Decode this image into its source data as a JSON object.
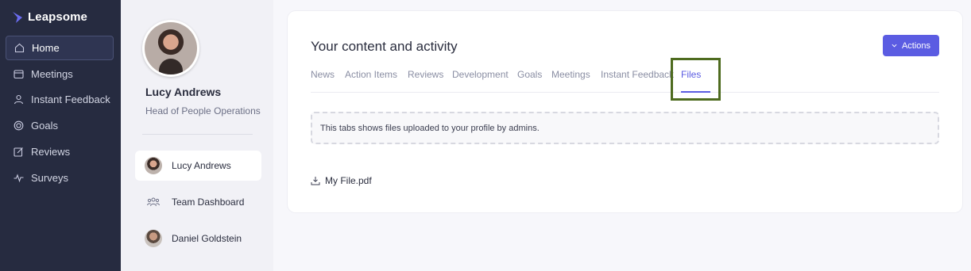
{
  "brand": {
    "name": "Leapsome",
    "accent": "#5b5ce2"
  },
  "nav": {
    "items": [
      {
        "label": "Home",
        "icon": "home-icon",
        "active": true
      },
      {
        "label": "Meetings",
        "icon": "meetings-icon",
        "active": false
      },
      {
        "label": "Instant Feedback",
        "icon": "feedback-icon",
        "active": false
      },
      {
        "label": "Goals",
        "icon": "goals-icon",
        "active": false
      },
      {
        "label": "Reviews",
        "icon": "reviews-icon",
        "active": false
      },
      {
        "label": "Surveys",
        "icon": "surveys-icon",
        "active": false
      }
    ]
  },
  "profile": {
    "name": "Lucy Andrews",
    "role": "Head of People Operations",
    "people": [
      {
        "label": "Lucy Andrews",
        "icon": "avatar",
        "selected": true
      },
      {
        "label": "Team Dashboard",
        "icon": "team-icon",
        "selected": false
      },
      {
        "label": "Daniel Goldstein",
        "icon": "avatar",
        "selected": false
      }
    ]
  },
  "main": {
    "title": "Your content and activity",
    "actions_label": "Actions",
    "tabs": [
      {
        "label": "News",
        "active": false
      },
      {
        "label": "Action Items",
        "active": false
      },
      {
        "label": "Reviews",
        "active": false
      },
      {
        "label": "Development",
        "active": false
      },
      {
        "label": "Goals",
        "active": false
      },
      {
        "label": "Meetings",
        "active": false
      },
      {
        "label": "Instant Feedback",
        "active": false
      },
      {
        "label": "Files",
        "active": true
      }
    ],
    "info_text": "This tabs shows files uploaded to your profile by admins.",
    "files": [
      {
        "name": "My File.pdf",
        "icon": "download-icon"
      }
    ]
  }
}
